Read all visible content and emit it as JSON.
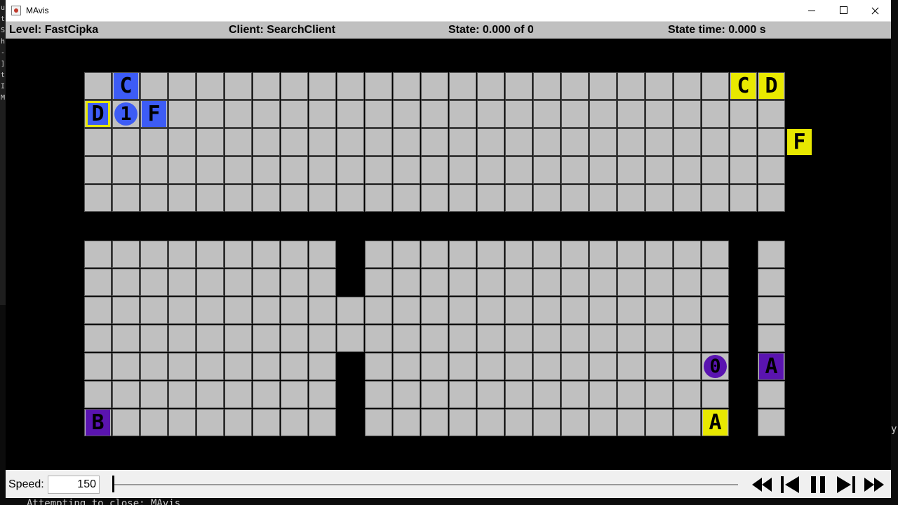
{
  "background_terminal": {
    "left_lines": [
      "u",
      "t",
      "S",
      "h",
      "-",
      "]",
      "t",
      "I",
      "M"
    ],
    "right_char": "y",
    "bottom_text": "Attempting to close: MAvis"
  },
  "window": {
    "title": "MAvis",
    "icon": "java-icon",
    "controls": [
      "minimize-icon",
      "maximize-icon",
      "close-icon"
    ]
  },
  "status": {
    "level_label": "Level: FastCipka",
    "client_label": "Client: SearchClient",
    "state_label": "State: 0.000 of 0",
    "time_label": "State time: 0.000 s"
  },
  "colors": {
    "wall": "#000000",
    "floor": "#c0c0c0",
    "grid_line": "#555555",
    "blue": "#3d5cf5",
    "purple": "#5a14b0",
    "yellow": "#e8e800"
  },
  "level": {
    "map": [
      "++++++++++++++++++++++++++++++",
      "++++++++++++++++++++++++++++++",
      "+++.........................++",
      "+++.........................++",
      "+++.........................++",
      "+++.........................++",
      "+++.........................++",
      "+++++.......................++",
      "+++.........+...............++",
      "+++.........+...............++",
      "+++.........................++",
      "+++.........................++",
      "+++.........+...............++",
      "+++.........+...............++",
      "+++.........+...............++",
      "++++++++++++++++++++++++++++++"
    ],
    "walls_on_row7": [
      5,
      6,
      7,
      8,
      9,
      10,
      11,
      12,
      13,
      14,
      15,
      16,
      17,
      18,
      19,
      20,
      21,
      22,
      23,
      24,
      25,
      26,
      27
    ],
    "walls_in_col26": [
      8,
      9,
      10,
      11,
      12,
      13,
      14
    ],
    "objects": [
      {
        "kind": "box",
        "letter": "C",
        "color": "blue",
        "row": 2,
        "col": 4
      },
      {
        "kind": "box",
        "letter": "D",
        "color": "blue",
        "row": 3,
        "col": 3,
        "on_goal": true
      },
      {
        "kind": "agent",
        "letter": "1",
        "color": "blue",
        "row": 3,
        "col": 4
      },
      {
        "kind": "box",
        "letter": "F",
        "color": "blue",
        "row": 3,
        "col": 5
      },
      {
        "kind": "goal",
        "letter": "C",
        "color": "yellow",
        "row": 2,
        "col": 26
      },
      {
        "kind": "goal",
        "letter": "D",
        "color": "yellow",
        "row": 2,
        "col": 27
      },
      {
        "kind": "goal",
        "letter": "F",
        "color": "yellow",
        "row": 4,
        "col": 28
      },
      {
        "kind": "agent",
        "letter": "0",
        "color": "purple",
        "row": 12,
        "col": 25
      },
      {
        "kind": "box",
        "letter": "A",
        "color": "purple",
        "row": 12,
        "col": 27
      },
      {
        "kind": "box",
        "letter": "B",
        "color": "purple",
        "row": 14,
        "col": 3
      },
      {
        "kind": "goal",
        "letter": "A",
        "color": "yellow",
        "row": 14,
        "col": 25
      }
    ]
  },
  "controls": {
    "speed_label": "Speed:",
    "speed_value": "150",
    "state_position": 0,
    "buttons": [
      "skip-back-icon",
      "step-back-icon",
      "pause-icon",
      "step-forward-icon",
      "skip-forward-icon"
    ]
  }
}
